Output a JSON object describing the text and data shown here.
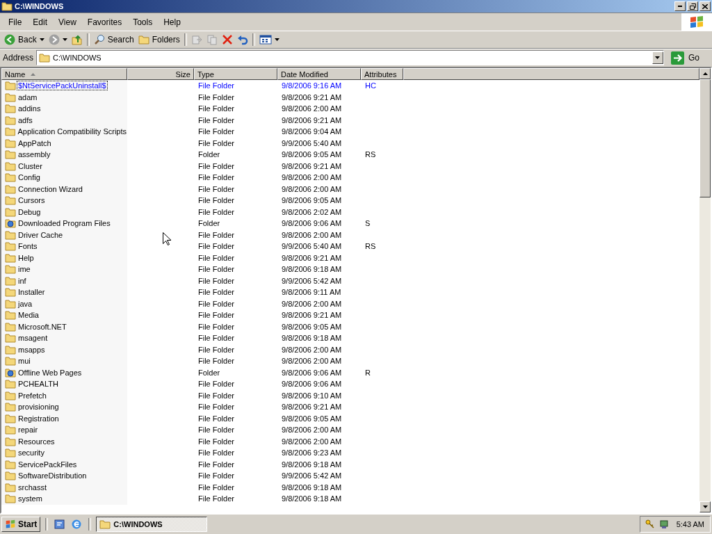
{
  "window": {
    "title": "C:\\WINDOWS",
    "active": true
  },
  "menu": [
    {
      "label": "File"
    },
    {
      "label": "Edit"
    },
    {
      "label": "View"
    },
    {
      "label": "Favorites"
    },
    {
      "label": "Tools"
    },
    {
      "label": "Help"
    }
  ],
  "toolbar": [
    {
      "kind": "back",
      "label": "Back",
      "disabled": false,
      "dropdown": true
    },
    {
      "kind": "forward",
      "disabled": true,
      "dropdown": true
    },
    {
      "kind": "up",
      "disabled": false,
      "dropdown": false
    },
    {
      "kind": "separator"
    },
    {
      "kind": "search",
      "label": "Search",
      "disabled": false,
      "dropdown": false
    },
    {
      "kind": "folders",
      "label": "Folders",
      "disabled": false,
      "dropdown": false
    },
    {
      "kind": "separator"
    },
    {
      "kind": "move",
      "disabled": true,
      "dropdown": false
    },
    {
      "kind": "copy",
      "disabled": true,
      "dropdown": false
    },
    {
      "kind": "delete",
      "disabled": false,
      "dropdown": false
    },
    {
      "kind": "undo",
      "disabled": false,
      "dropdown": false
    },
    {
      "kind": "separator"
    },
    {
      "kind": "views",
      "disabled": false,
      "dropdown": true
    }
  ],
  "address": {
    "label": "Address",
    "value": "C:\\WINDOWS",
    "go": "Go"
  },
  "columns": [
    {
      "label": "Name",
      "sorted": true
    },
    {
      "label": "Size",
      "sorted": false
    },
    {
      "label": "Type",
      "sorted": false
    },
    {
      "label": "Date Modified",
      "sorted": false
    },
    {
      "label": "Attributes",
      "sorted": false
    }
  ],
  "rows": [
    {
      "kind": "folder",
      "name": "$NtServicePackUninstall$",
      "type": "File Folder",
      "date": "9/8/2006 9:16 AM",
      "attributes": "HC",
      "selected": true,
      "compressed": true
    },
    {
      "kind": "folder",
      "name": "adam",
      "type": "File Folder",
      "date": "9/8/2006 9:21 AM",
      "selected": false,
      "compressed": false
    },
    {
      "kind": "folder",
      "name": "addins",
      "type": "File Folder",
      "date": "9/8/2006 2:00 AM",
      "selected": false,
      "compressed": false
    },
    {
      "kind": "folder",
      "name": "adfs",
      "type": "File Folder",
      "date": "9/8/2006 9:21 AM",
      "selected": false,
      "compressed": false
    },
    {
      "kind": "folder",
      "name": "Application Compatibility Scripts",
      "type": "File Folder",
      "date": "9/8/2006 9:04 AM",
      "selected": false,
      "compressed": false
    },
    {
      "kind": "folder",
      "name": "AppPatch",
      "type": "File Folder",
      "date": "9/9/2006 5:40 AM",
      "selected": false,
      "compressed": false
    },
    {
      "kind": "folder",
      "name": "assembly",
      "type": "Folder",
      "date": "9/8/2006 9:05 AM",
      "attributes": "RS",
      "selected": false,
      "compressed": false
    },
    {
      "kind": "folder",
      "name": "Cluster",
      "type": "File Folder",
      "date": "9/8/2006 9:21 AM",
      "selected": false,
      "compressed": false
    },
    {
      "kind": "folder",
      "name": "Config",
      "type": "File Folder",
      "date": "9/8/2006 2:00 AM",
      "selected": false,
      "compressed": false
    },
    {
      "kind": "folder",
      "name": "Connection Wizard",
      "type": "File Folder",
      "date": "9/8/2006 2:00 AM",
      "selected": false,
      "compressed": false
    },
    {
      "kind": "folder",
      "name": "Cursors",
      "type": "File Folder",
      "date": "9/8/2006 9:05 AM",
      "selected": false,
      "compressed": false
    },
    {
      "kind": "folder",
      "name": "Debug",
      "type": "File Folder",
      "date": "9/8/2006 2:02 AM",
      "selected": false,
      "compressed": false
    },
    {
      "kind": "special",
      "name": "Downloaded Program Files",
      "type": "Folder",
      "date": "9/8/2006 9:06 AM",
      "attributes": "S",
      "selected": false,
      "compressed": false
    },
    {
      "kind": "folder",
      "name": "Driver Cache",
      "type": "File Folder",
      "date": "9/8/2006 2:00 AM",
      "selected": false,
      "compressed": false
    },
    {
      "kind": "folder",
      "name": "Fonts",
      "type": "File Folder",
      "date": "9/9/2006 5:40 AM",
      "attributes": "RS",
      "selected": false,
      "compressed": false
    },
    {
      "kind": "folder",
      "name": "Help",
      "type": "File Folder",
      "date": "9/8/2006 9:21 AM",
      "selected": false,
      "compressed": false
    },
    {
      "kind": "folder",
      "name": "ime",
      "type": "File Folder",
      "date": "9/8/2006 9:18 AM",
      "selected": false,
      "compressed": false
    },
    {
      "kind": "folder",
      "name": "inf",
      "type": "File Folder",
      "date": "9/9/2006 5:42 AM",
      "selected": false,
      "compressed": false
    },
    {
      "kind": "folder",
      "name": "Installer",
      "type": "File Folder",
      "date": "9/8/2006 9:11 AM",
      "selected": false,
      "compressed": false
    },
    {
      "kind": "folder",
      "name": "java",
      "type": "File Folder",
      "date": "9/8/2006 2:00 AM",
      "selected": false,
      "compressed": false
    },
    {
      "kind": "folder",
      "name": "Media",
      "type": "File Folder",
      "date": "9/8/2006 9:21 AM",
      "selected": false,
      "compressed": false
    },
    {
      "kind": "folder",
      "name": "Microsoft.NET",
      "type": "File Folder",
      "date": "9/8/2006 9:05 AM",
      "selected": false,
      "compressed": false
    },
    {
      "kind": "folder",
      "name": "msagent",
      "type": "File Folder",
      "date": "9/8/2006 9:18 AM",
      "selected": false,
      "compressed": false
    },
    {
      "kind": "folder",
      "name": "msapps",
      "type": "File Folder",
      "date": "9/8/2006 2:00 AM",
      "selected": false,
      "compressed": false
    },
    {
      "kind": "folder",
      "name": "mui",
      "type": "File Folder",
      "date": "9/8/2006 2:00 AM",
      "selected": false,
      "compressed": false
    },
    {
      "kind": "special",
      "name": "Offline Web Pages",
      "type": "Folder",
      "date": "9/8/2006 9:06 AM",
      "attributes": "R",
      "selected": false,
      "compressed": false
    },
    {
      "kind": "folder",
      "name": "PCHEALTH",
      "type": "File Folder",
      "date": "9/8/2006 9:06 AM",
      "selected": false,
      "compressed": false
    },
    {
      "kind": "folder",
      "name": "Prefetch",
      "type": "File Folder",
      "date": "9/8/2006 9:10 AM",
      "selected": false,
      "compressed": false
    },
    {
      "kind": "folder",
      "name": "provisioning",
      "type": "File Folder",
      "date": "9/8/2006 9:21 AM",
      "selected": false,
      "compressed": false
    },
    {
      "kind": "folder",
      "name": "Registration",
      "type": "File Folder",
      "date": "9/8/2006 9:05 AM",
      "selected": false,
      "compressed": false
    },
    {
      "kind": "folder",
      "name": "repair",
      "type": "File Folder",
      "date": "9/8/2006 2:00 AM",
      "selected": false,
      "compressed": false
    },
    {
      "kind": "folder",
      "name": "Resources",
      "type": "File Folder",
      "date": "9/8/2006 2:00 AM",
      "selected": false,
      "compressed": false
    },
    {
      "kind": "folder",
      "name": "security",
      "type": "File Folder",
      "date": "9/8/2006 9:23 AM",
      "selected": false,
      "compressed": false
    },
    {
      "kind": "folder",
      "name": "ServicePackFiles",
      "type": "File Folder",
      "date": "9/8/2006 9:18 AM",
      "selected": false,
      "compressed": false
    },
    {
      "kind": "folder",
      "name": "SoftwareDistribution",
      "type": "File Folder",
      "date": "9/9/2006 5:42 AM",
      "selected": false,
      "compressed": false
    },
    {
      "kind": "folder",
      "name": "srchasst",
      "type": "File Folder",
      "date": "9/8/2006 9:18 AM",
      "selected": false,
      "compressed": false
    },
    {
      "kind": "folder",
      "name": "system",
      "type": "File Folder",
      "date": "9/8/2006 9:18 AM",
      "selected": false,
      "compressed": false
    }
  ],
  "taskbar": {
    "start": "Start",
    "tasks": [
      {
        "label": "C:\\WINDOWS",
        "selected": true
      }
    ],
    "clock": "5:43 AM"
  }
}
